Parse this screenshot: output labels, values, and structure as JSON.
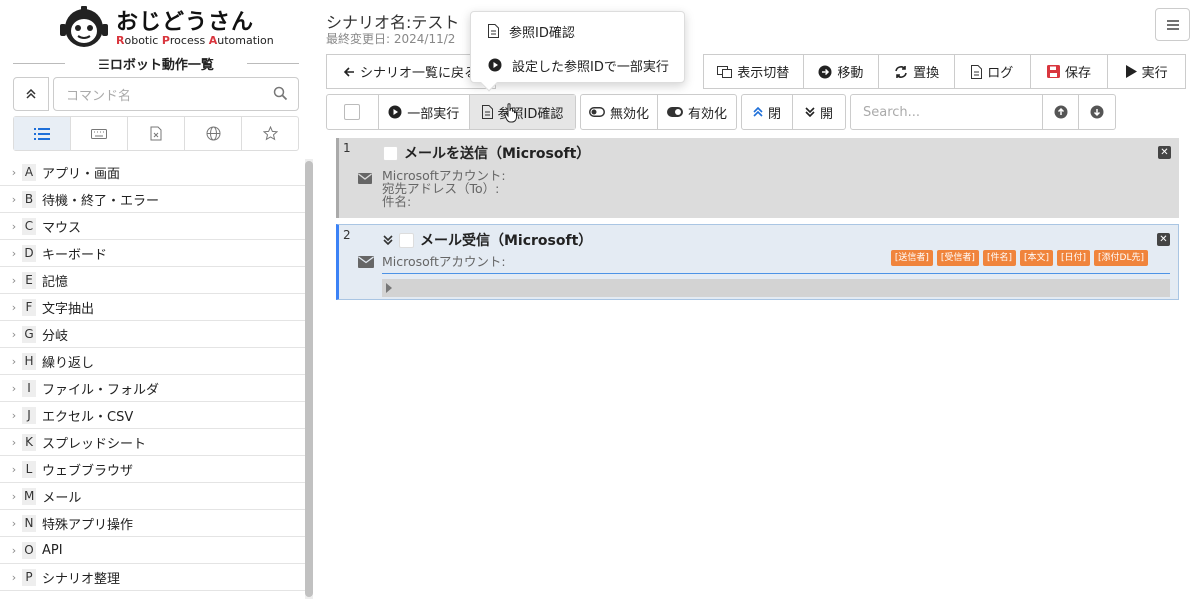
{
  "brand": {
    "name": "おじどうさん",
    "subtitle_parts": [
      "R",
      "obotic ",
      "P",
      "rocess ",
      "A",
      "utomation"
    ]
  },
  "sidebar": {
    "title": "ロボット動作一覧",
    "search_placeholder": "コマンド名",
    "tabs": [
      "list",
      "keyboard",
      "file",
      "globe",
      "star"
    ],
    "categories": [
      {
        "letter": "A",
        "label": "アプリ・画面"
      },
      {
        "letter": "B",
        "label": "待機・終了・エラー"
      },
      {
        "letter": "C",
        "label": "マウス"
      },
      {
        "letter": "D",
        "label": "キーボード"
      },
      {
        "letter": "E",
        "label": "記憶"
      },
      {
        "letter": "F",
        "label": "文字抽出"
      },
      {
        "letter": "G",
        "label": "分岐"
      },
      {
        "letter": "H",
        "label": "繰り返し"
      },
      {
        "letter": "I",
        "label": "ファイル・フォルダ"
      },
      {
        "letter": "J",
        "label": "エクセル・CSV"
      },
      {
        "letter": "K",
        "label": "スプレッドシート"
      },
      {
        "letter": "L",
        "label": "ウェブブラウザ"
      },
      {
        "letter": "M",
        "label": "メール"
      },
      {
        "letter": "N",
        "label": "特殊アプリ操作"
      },
      {
        "letter": "O",
        "label": "API"
      },
      {
        "letter": "P",
        "label": "シナリオ整理"
      }
    ]
  },
  "header": {
    "scenario_title": "シナリオ名:テスト",
    "last_modified": "最終変更日: 2024/11/2"
  },
  "toolbar1": {
    "back": "シナリオ一覧に戻る",
    "display_toggle": "表示切替",
    "move": "移動",
    "replace": "置換",
    "log": "ログ",
    "save": "保存",
    "run": "実行"
  },
  "toolbar2": {
    "partial_run": "一部実行",
    "ref_id_check": "参照ID確認",
    "disable": "無効化",
    "enable": "有効化",
    "close": "閉",
    "open": "開",
    "search_placeholder": "Search..."
  },
  "dropdown": {
    "items": [
      "参照ID確認",
      "設定した参照IDで一部実行"
    ]
  },
  "steps": [
    {
      "number": "1",
      "title": "メールを送信（Microsoft）",
      "fields": [
        "Microsoftアカウント:",
        "宛先アドレス（To）:",
        "件名:"
      ]
    },
    {
      "number": "2",
      "title": "メール受信（Microsoft）",
      "fields": [
        "Microsoftアカウント:"
      ],
      "tags": [
        "[送信者]",
        "[受信者]",
        "[件名]",
        "[本文]",
        "[日付]",
        "[添付DL先]"
      ]
    }
  ],
  "colors": {
    "accent": "#1e6fd9",
    "save_red": "#d9363e",
    "tag_orange": "#f0843c",
    "selected_border": "#3b82f6"
  }
}
